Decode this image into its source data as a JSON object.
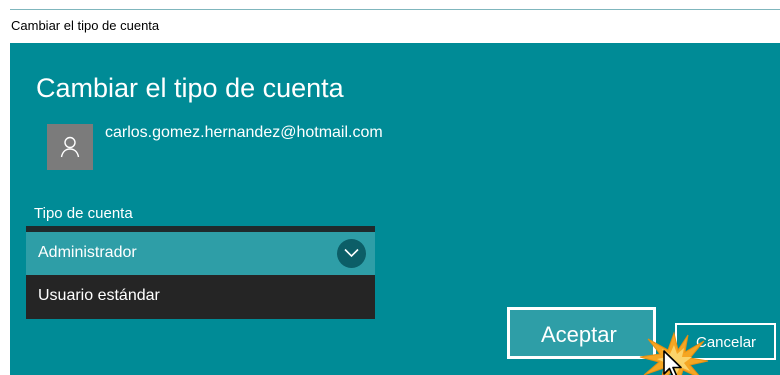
{
  "window": {
    "title": "Cambiar el tipo de cuenta"
  },
  "dialog": {
    "heading": "Cambiar el tipo de cuenta",
    "account": {
      "avatar_icon": "person-icon",
      "email": "carlos.gomez.hernandez@hotmail.com"
    },
    "account_type": {
      "label": "Tipo de cuenta",
      "selected": "Administrador",
      "expand_icon": "chevron-down-icon",
      "options": [
        "Administrador",
        "Usuario estándar"
      ]
    },
    "buttons": {
      "accept_label": "Aceptar",
      "cancel_label": "Cancelar"
    }
  },
  "colors": {
    "dialog_background": "#008b96",
    "selected_option": "#2e9ea7",
    "dropdown_dark": "#252525",
    "chevron_circle": "#0c5e67",
    "avatar_background": "#7b7b7b",
    "click_burst": "#f5a623"
  }
}
